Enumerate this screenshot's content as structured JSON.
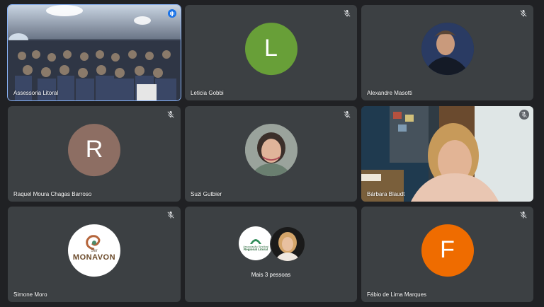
{
  "participants": [
    {
      "name": "Assessoria Litoral"
    },
    {
      "name": "Leticia Gobbi",
      "initial": "L",
      "color": "#689f38"
    },
    {
      "name": "Alexandre Masotti"
    },
    {
      "name": "Raquel Moura Chagas Barroso",
      "initial": "R",
      "color": "#8d6e63"
    },
    {
      "name": "Suzi Gutbier"
    },
    {
      "name": "Bárbara Blaudt"
    },
    {
      "name": "Simone Moro",
      "logo_text": "MONAVON",
      "logo_subtext": "Ser"
    },
    {
      "group_label": "Mais 3 pessoas",
      "logo_text_1": "Associação Sindical",
      "logo_text_2": "Regional Litoral"
    },
    {
      "name": "Fábio de Lima Marques",
      "initial": "F",
      "color": "#ef6c00"
    }
  ],
  "icons": {
    "muted_mic": "mic-off-icon",
    "speaking": "audio-level-icon"
  }
}
